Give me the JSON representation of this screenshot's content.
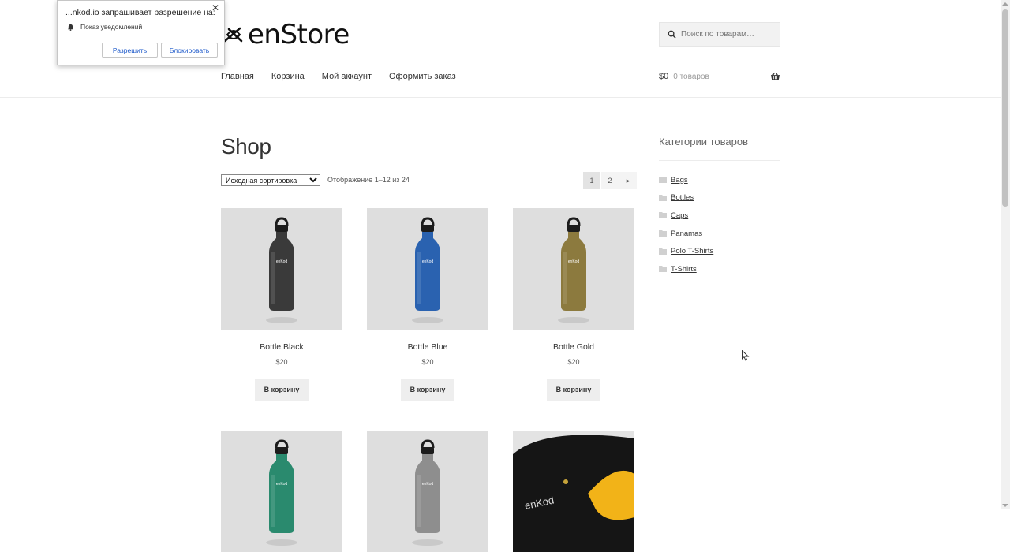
{
  "popup": {
    "title": "...nkod.io запрашивает разрешение на:",
    "permission": "Показ уведомлений",
    "allow_label": "Разрешить",
    "block_label": "Блокировать",
    "close_symbol": "✕"
  },
  "header": {
    "logo_text": "enStore",
    "search_placeholder": "Поиск по товарам…",
    "nav": [
      "Главная",
      "Корзина",
      "Мой аккаунт",
      "Оформить заказ"
    ],
    "cart_amount": "$0",
    "cart_count": "0 товаров"
  },
  "shop": {
    "title": "Shop",
    "sort_selected": "Исходная сортировка",
    "showing": "Отображение 1–12 из 24",
    "pages": [
      "1",
      "2"
    ],
    "next_symbol": "▸"
  },
  "products": [
    {
      "name": "Bottle Black",
      "price": "$20",
      "button": "В корзину",
      "color": "#3a3a3a"
    },
    {
      "name": "Bottle Blue",
      "price": "$20",
      "button": "В корзину",
      "color": "#2a62b0"
    },
    {
      "name": "Bottle Gold",
      "price": "$20",
      "button": "В корзину",
      "color": "#8c7a3e"
    },
    {
      "name": "",
      "price": "",
      "button": "",
      "color": "#2a8a6e"
    },
    {
      "name": "",
      "price": "",
      "button": "",
      "color": "#8e8e8e"
    },
    {
      "name": "",
      "price": "",
      "button": "",
      "color": "#111111"
    }
  ],
  "bottle_brand": "enKod",
  "cap_brand": "enKod",
  "sidebar": {
    "title": "Категории товаров",
    "categories": [
      "Bags",
      "Bottles",
      "Caps",
      "Panamas",
      "Polo T-Shirts",
      "T-Shirts"
    ]
  }
}
